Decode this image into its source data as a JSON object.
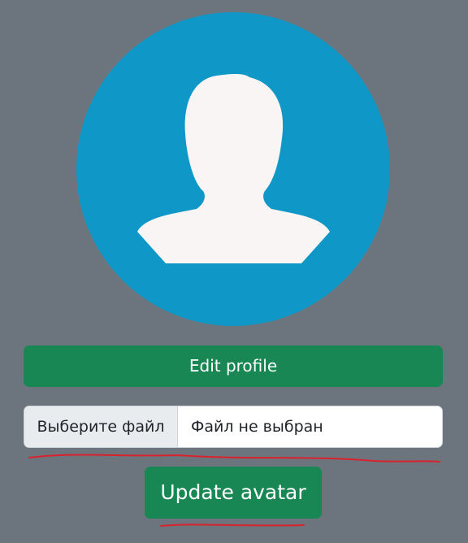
{
  "avatar": {
    "icon": "user-silhouette-icon",
    "circle_color": "#0f97c7",
    "figure_color": "#faf5f5"
  },
  "profile": {
    "edit_label": "Edit profile",
    "button_color": "#198754"
  },
  "file_input": {
    "choose_label": "Выберите файл",
    "status_text": "Файл не выбран"
  },
  "avatar_form": {
    "update_label": "Update avatar"
  },
  "annotations": {
    "underline_color": "#d9232c"
  }
}
